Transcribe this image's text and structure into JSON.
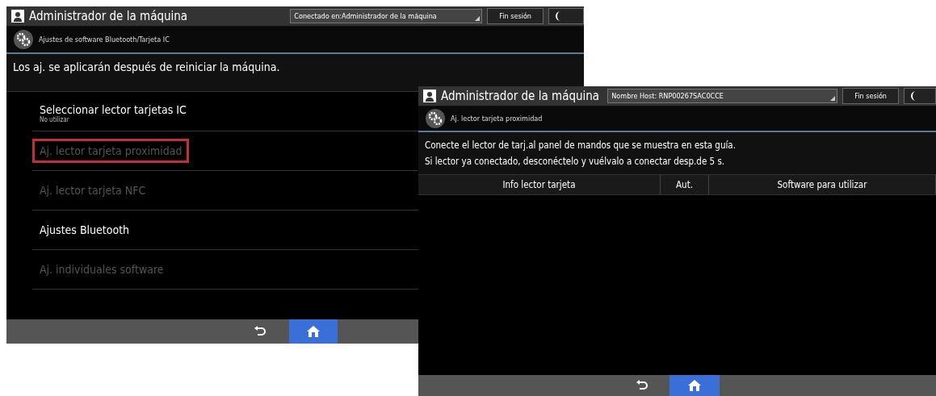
{
  "screens": [
    {
      "kind": "list",
      "header": {
        "title": "Administrador de la máquina",
        "field": "Conectado en:Administrador de la máquina",
        "logout": "Fin sesión"
      },
      "breadcrumb": "Ajustes de software Bluetooth/Tarjeta IC",
      "message": [
        "Los aj. se aplicarán después de reiniciar la máquina."
      ],
      "items": [
        {
          "label": "Seleccionar lector tarjetas IC",
          "sub": "No utilizar",
          "disabled": false,
          "highlighted": false
        },
        {
          "label": "Aj. lector tarjeta proximidad",
          "disabled": true,
          "highlighted": true
        },
        {
          "label": "Aj. lector tarjeta NFC",
          "disabled": true,
          "highlighted": false
        },
        {
          "label": "Ajustes Bluetooth",
          "disabled": false,
          "highlighted": false
        },
        {
          "label": "Aj. individuales software",
          "disabled": true,
          "highlighted": false
        }
      ]
    },
    {
      "kind": "table",
      "header": {
        "title": "Administrador de la máquina",
        "field": "Nombre Host: RNP00267SAC0CCE",
        "logout": "Fin sesión"
      },
      "breadcrumb": "Aj. lector tarjeta proximidad",
      "message": [
        "Conecte el lector de tarj.al panel de mandos que se muestra en esta guía.",
        "Si lector ya conectado, desconéctelo y vuélvalo a conectar desp.de 5 s."
      ],
      "columns": [
        "Info lector tarjeta",
        "Aut.",
        "Software para utilizar"
      ]
    }
  ]
}
